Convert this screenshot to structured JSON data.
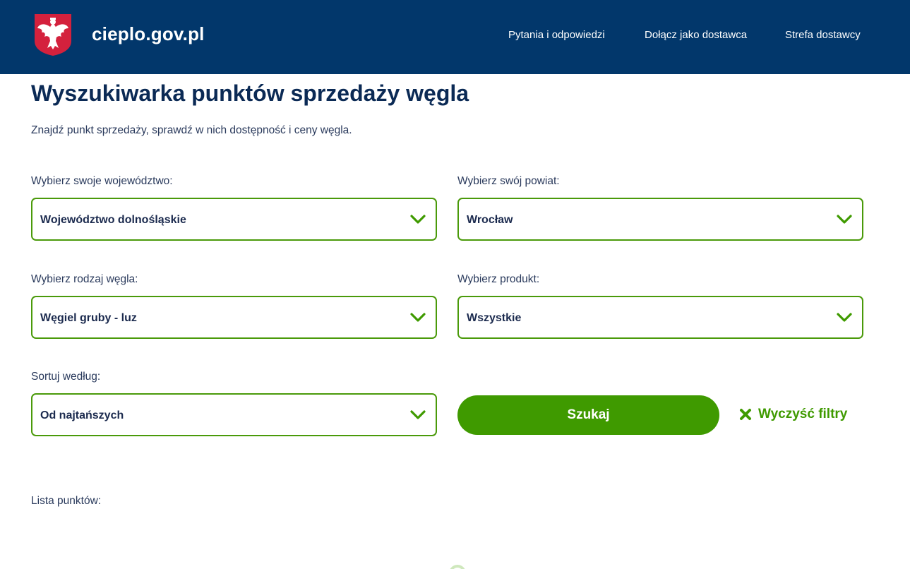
{
  "header": {
    "site_name": "cieplo.gov.pl",
    "logo_icon": "polish-eagle-emblem-icon",
    "nav": [
      {
        "label": "Pytania i odpowiedzi"
      },
      {
        "label": "Dołącz jako dostawca"
      },
      {
        "label": "Strefa dostawcy"
      }
    ]
  },
  "main": {
    "title": "Wyszukiwarka punktów sprzedaży węgla",
    "subtitle": "Znajdź punkt sprzedaży, sprawdź w nich dostępność i ceny węgla."
  },
  "filters": {
    "voivodeship": {
      "label": "Wybierz swoje województwo:",
      "value": "Województwo dolnośląskie"
    },
    "county": {
      "label": "Wybierz swój powiat:",
      "value": "Wrocław"
    },
    "coal_type": {
      "label": "Wybierz rodzaj węgla:",
      "value": "Węgiel gruby - luz"
    },
    "product": {
      "label": "Wybierz produkt:",
      "value": "Wszystkie"
    },
    "sort": {
      "label": "Sortuj według:",
      "value": "Od najtańszych"
    },
    "chevron_icon": "chevron-down-icon",
    "search_label": "Szukaj",
    "clear_label": "Wyczyść filtry",
    "clear_icon": "close-x-icon"
  },
  "results": {
    "list_label": "Lista punktów:"
  },
  "colors": {
    "header_bg": "#02376b",
    "accent_green": "#3f9a00",
    "title_navy": "#0b2a55"
  }
}
